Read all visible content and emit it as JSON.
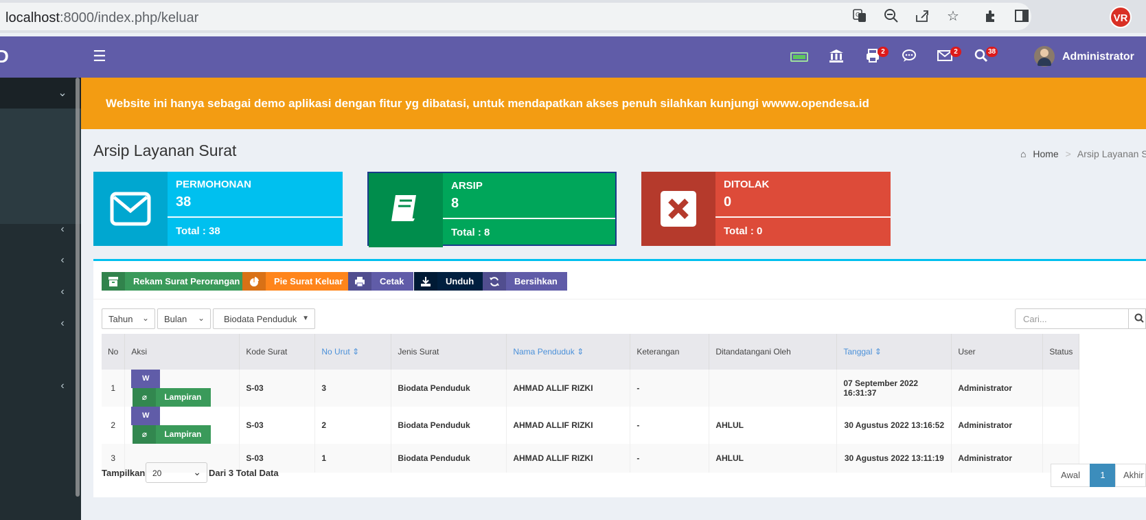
{
  "browser": {
    "url_host": "localhost",
    "url_path": ":8000/index.php/keluar",
    "profile_initials": "VR"
  },
  "sidebar": {
    "logo_char": "D"
  },
  "header": {
    "nav_badges": {
      "print": "2",
      "mail": "2",
      "search": "38"
    },
    "user_name": "Administrator"
  },
  "alert": {
    "message": "Website ini hanya sebagai demo aplikasi dengan fitur yg dibatasi, untuk mendapatkan akses penuh silahkan kunjungi wwww.opendesa.id"
  },
  "page": {
    "title": "Arsip Layanan Surat",
    "breadcrumb_home": "Home",
    "breadcrumb_sep": ">",
    "breadcrumb_current": "Arsip Layanan S"
  },
  "stats": [
    {
      "label": "PERMOHONAN",
      "value": "38",
      "total": "Total : 38",
      "color": "#00c0ef",
      "icon_color": "#00a7d0"
    },
    {
      "label": "ARSIP",
      "value": "8",
      "total": "Total : 8",
      "color": "#00a65a",
      "icon_color": "#008d4c"
    },
    {
      "label": "DITOLAK",
      "value": "0",
      "total": "Total : 0",
      "color": "#dd4b39",
      "icon_color": "#b53a2c"
    }
  ],
  "toolbar": {
    "rekam": "Rekam Surat Perorangan",
    "pie": "Pie Surat Keluar",
    "cetak": "Cetak",
    "unduh": "Unduh",
    "bersihkan": "Bersihkan"
  },
  "filters": {
    "tahun": "Tahun",
    "bulan": "Bulan",
    "jenis": "Biodata Penduduk",
    "search_placeholder": "Cari..."
  },
  "table": {
    "headers": {
      "no": "No",
      "aksi": "Aksi",
      "kode": "Kode Surat",
      "no_urut": "No Urut",
      "jenis": "Jenis Surat",
      "nama": "Nama Penduduk",
      "keterangan": "Keterangan",
      "ditandatangani": "Ditandatangani Oleh",
      "tanggal": "Tanggal",
      "user": "User",
      "status": "Status"
    },
    "lampiran_label": "Lampiran",
    "word_label": "W",
    "rows": [
      {
        "no": "1",
        "kode": "S-03",
        "no_urut": "3",
        "jenis": "Biodata Penduduk",
        "nama": "AHMAD ALLIF RIZKI",
        "keterangan": "-",
        "ditandatangani": "",
        "tanggal": "07 September 2022 16:31:37",
        "user": "Administrator",
        "status": ""
      },
      {
        "no": "2",
        "kode": "S-03",
        "no_urut": "2",
        "jenis": "Biodata Penduduk",
        "nama": "AHMAD ALLIF RIZKI",
        "keterangan": "-",
        "ditandatangani": "AHLUL",
        "tanggal": "30 Agustus 2022 13:16:52",
        "user": "Administrator",
        "status": ""
      },
      {
        "no": "3",
        "kode": "S-03",
        "no_urut": "1",
        "jenis": "Biodata Penduduk",
        "nama": "AHMAD ALLIF RIZKI",
        "keterangan": "-",
        "ditandatangani": "AHLUL",
        "tanggal": "30 Agustus 2022 13:11:19",
        "user": "Administrator",
        "status": ""
      }
    ]
  },
  "footer": {
    "tampilkan": "Tampilkan",
    "per_page": "20",
    "total_text": "Dari 3 Total Data",
    "pages": {
      "first": "Awal",
      "current": "1",
      "last": "Akhir"
    }
  }
}
